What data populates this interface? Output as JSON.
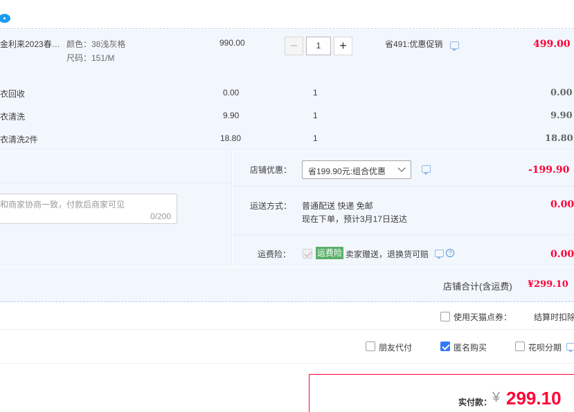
{
  "item": {
    "title": "金利来2023春…",
    "color_spec": "颜色：38浅灰格",
    "size_spec": "尺码：151/M",
    "unit_price": "990.00",
    "quantity": "1",
    "minus": "−",
    "plus": "+",
    "promo": "省491:优惠促销",
    "subtotal": "499.00"
  },
  "services": [
    {
      "name": "衣回收",
      "price": "0.00",
      "qty": "1",
      "subtotal": "0.00"
    },
    {
      "name": "衣清洗",
      "price": "9.90",
      "qty": "1",
      "subtotal": "9.90"
    },
    {
      "name": "衣清洗2件",
      "price": "18.80",
      "qty": "1",
      "subtotal": "18.80"
    }
  ],
  "memo": {
    "placeholder": "和商家协商一致，付款后商家可见",
    "counter": "0/200"
  },
  "shop": {
    "discount_label": "店铺优惠：",
    "discount_select": "省199.90元:组合优惠",
    "discount_amount": "-199.90",
    "shipping_label": "运送方式：",
    "shipping_method": "普通配送 快递 免邮",
    "shipping_eta": "现在下单，预计3月17日送达",
    "shipping_amount": "0.00",
    "insurance_label": "运费险：",
    "insurance_tag": "运费险",
    "insurance_desc": "卖家赠送，退换货可赔",
    "insurance_amount": "0.00",
    "help_glyph": "?",
    "total_label": "店铺合计(含运费)",
    "total_amount": "¥299.10"
  },
  "options": {
    "tmall_points": "使用天猫点券：",
    "tmall_points_note": "结算时扣除",
    "friend_pay": "朋友代付",
    "anonymous": "匿名购买",
    "huabei": "花呗分期"
  },
  "payment": {
    "label": "实付款：",
    "currency": "¥",
    "amount": "299.10"
  },
  "colors": {
    "accent_red": "#ff0036",
    "panel_bg": "#f2f7fe",
    "checkbox_blue": "#3579f6",
    "tag_green": "#5bb06a"
  }
}
